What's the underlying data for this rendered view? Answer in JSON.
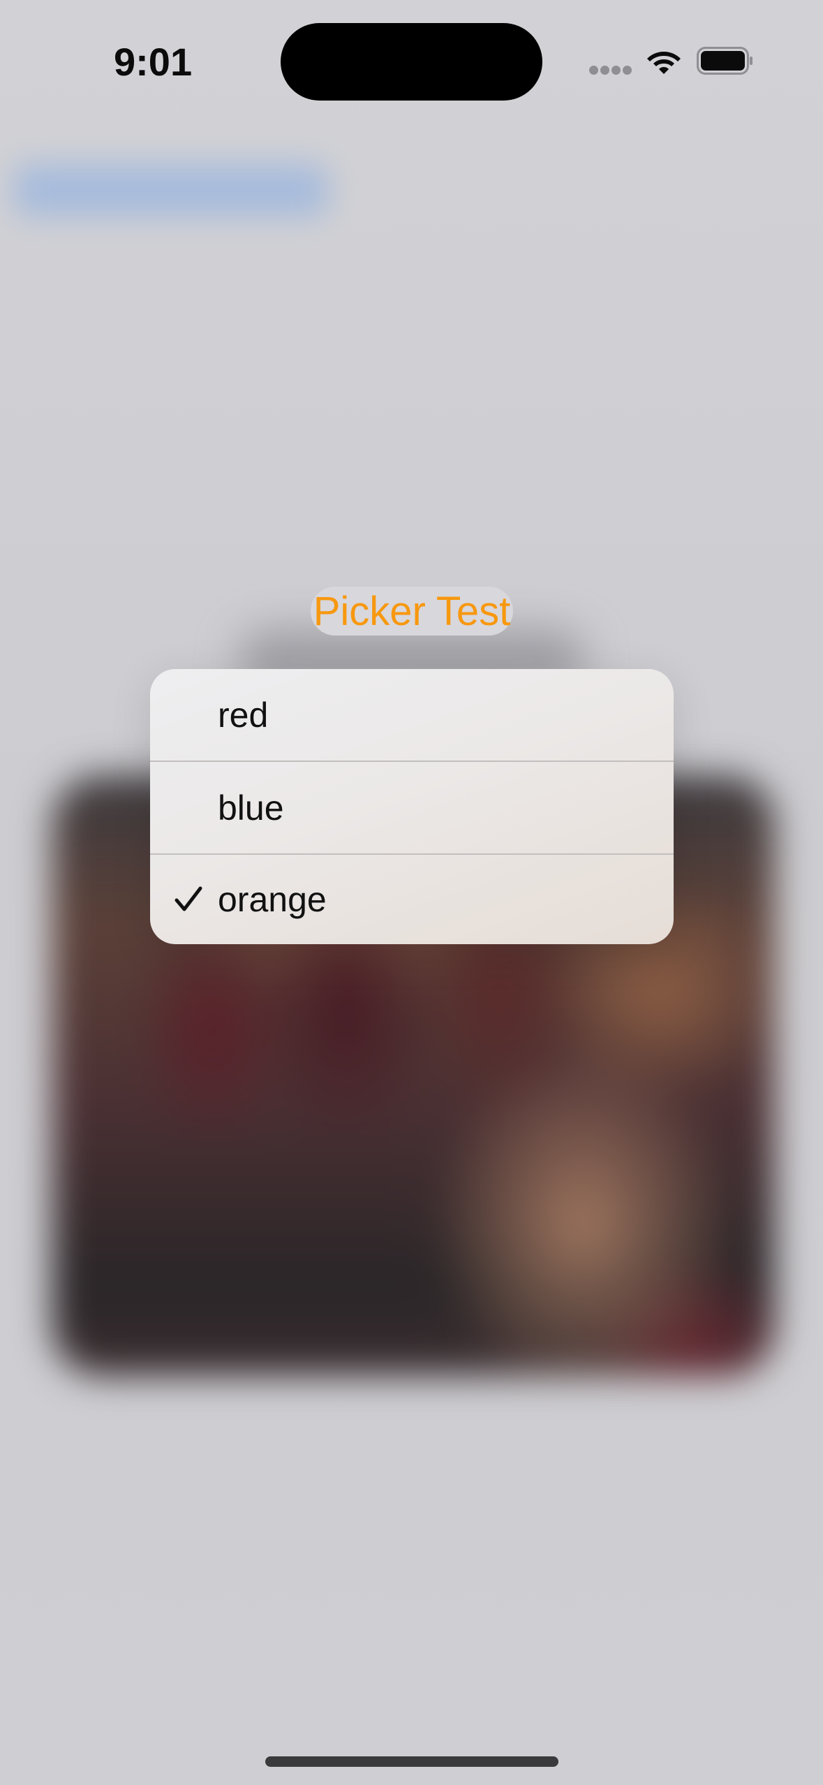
{
  "status_bar": {
    "time": "9:01",
    "icons": [
      "cellular-dots-icon",
      "wifi-icon",
      "battery-icon"
    ]
  },
  "picker": {
    "label": "Picker Test",
    "accent_color": "#f7980f",
    "selected": "orange"
  },
  "menu": {
    "items": [
      {
        "label": "red",
        "checked": false
      },
      {
        "label": "blue",
        "checked": false
      },
      {
        "label": "orange",
        "checked": true
      }
    ],
    "check_icon": "checkmark-icon"
  }
}
